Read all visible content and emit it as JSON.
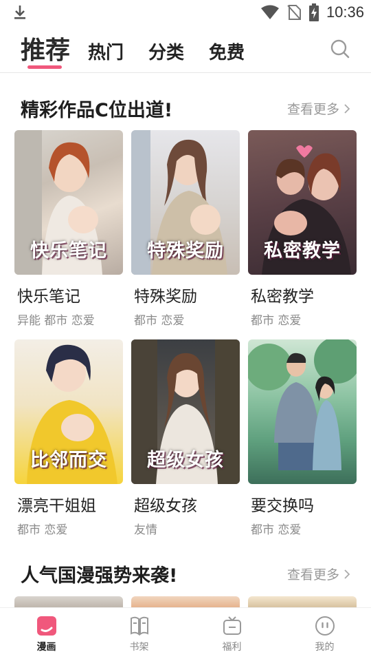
{
  "status_bar": {
    "time": "10:36",
    "icons": [
      "download-icon",
      "wifi-icon",
      "no-sim-icon",
      "battery-charging-icon"
    ]
  },
  "top_tabs": [
    {
      "label": "推荐",
      "active": true
    },
    {
      "label": "热门",
      "active": false
    },
    {
      "label": "分类",
      "active": false
    },
    {
      "label": "免费",
      "active": false
    }
  ],
  "search_icon": "search-icon",
  "accent_color": "#f0587c",
  "section1": {
    "title": "精彩作品C位出道!",
    "more_label": "查看更多",
    "items": [
      {
        "title": "快乐笔记",
        "tags": "异能 都市 恋爱",
        "cover_text": "快乐笔记"
      },
      {
        "title": "特殊奖励",
        "tags": "都市 恋爱",
        "cover_text": "特殊奖励"
      },
      {
        "title": "私密教学",
        "tags": "都市 恋爱",
        "cover_text": "私密教学"
      },
      {
        "title": "漂亮干姐姐",
        "tags": "都市 恋爱",
        "cover_text": "比邻而交"
      },
      {
        "title": "超级女孩",
        "tags": "友情",
        "cover_text": "超级女孩"
      },
      {
        "title": "要交换吗",
        "tags": "都市 恋爱",
        "cover_text": ""
      }
    ]
  },
  "section2": {
    "title": "人气国漫强势来袭!",
    "more_label": "查看更多"
  },
  "bottom_nav": [
    {
      "label": "漫画",
      "icon": "comic-icon",
      "active": true
    },
    {
      "label": "书架",
      "icon": "bookshelf-icon",
      "active": false
    },
    {
      "label": "福利",
      "icon": "gift-tv-icon",
      "active": false
    },
    {
      "label": "我的",
      "icon": "profile-icon",
      "active": false
    }
  ]
}
